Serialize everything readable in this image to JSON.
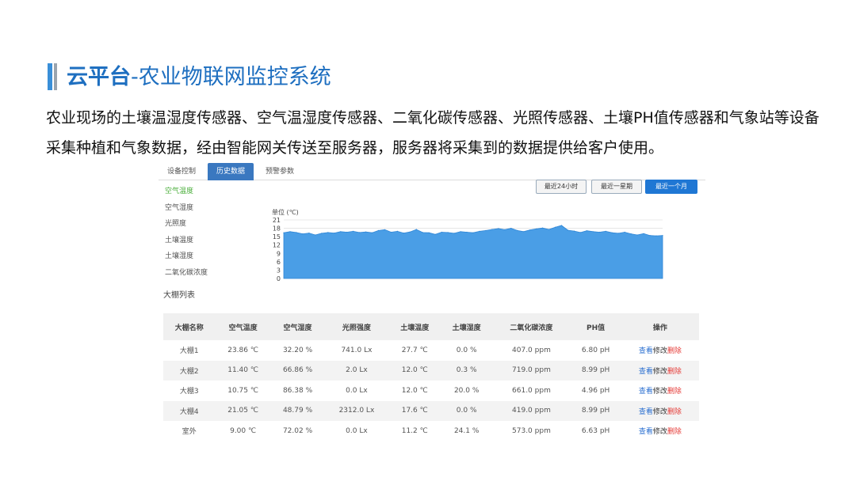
{
  "heading": {
    "title_bold": "云平台",
    "title_rest": "-农业物联网监控系统",
    "paragraph": "农业现场的土壤温湿度传感器、空气温湿度传感器、二氧化碳传感器、光照传感器、土壤PH值传感器和气象站等设备采集种植和气象数据，经由智能网关传送至服务器，服务器将采集到的数据提供给客户使用。"
  },
  "colors": {
    "accent": "#3a8fd8",
    "chart_fill": "#4a9ee6",
    "tab_active": "#3a78c0",
    "range_active": "#1f77d4",
    "link": "#2a6fd0",
    "delete": "#e53935"
  },
  "tabs": [
    {
      "label": "设备控制",
      "active": false
    },
    {
      "label": "历史数据",
      "active": true
    },
    {
      "label": "预警参数",
      "active": false
    }
  ],
  "sidebar": [
    {
      "label": "空气温度",
      "active": true
    },
    {
      "label": "空气湿度",
      "active": false
    },
    {
      "label": "光照度",
      "active": false
    },
    {
      "label": "土壤温度",
      "active": false
    },
    {
      "label": "土壤湿度",
      "active": false
    },
    {
      "label": "二氧化碳浓度",
      "active": false
    }
  ],
  "range_buttons": [
    {
      "label": "最近24小时",
      "active": false
    },
    {
      "label": "最近一星期",
      "active": false
    },
    {
      "label": "最近一个月",
      "active": true
    }
  ],
  "chart_data": {
    "type": "area",
    "unit_label": "单位 (℃)",
    "ylim": [
      0,
      21
    ],
    "yticks": [
      21,
      18,
      15,
      12,
      9,
      6,
      3,
      0
    ],
    "grid": true,
    "values": [
      16.4,
      16.8,
      16.5,
      16.0,
      16.3,
      15.6,
      16.2,
      16.5,
      16.3,
      16.8,
      16.6,
      16.9,
      16.5,
      16.7,
      16.4,
      17.2,
      17.5,
      16.6,
      16.9,
      16.3,
      16.7,
      17.6,
      16.5,
      16.4,
      15.8,
      16.6,
      16.5,
      16.2,
      16.8,
      16.6,
      16.4,
      16.9,
      17.2,
      17.6,
      17.9,
      17.5,
      18.0,
      17.2,
      16.8,
      17.4,
      17.8,
      18.1,
      17.6,
      18.4,
      19.0,
      17.3,
      17.0,
      16.5,
      17.1,
      16.8,
      16.6,
      16.9,
      16.4,
      16.2,
      16.6,
      16.0,
      15.6,
      16.1,
      15.4,
      15.3,
      15.4
    ]
  },
  "list": {
    "title": "大棚列表",
    "headers": [
      "大棚名称",
      "空气温度",
      "空气湿度",
      "光照强度",
      "土壤温度",
      "土壤湿度",
      "二氧化碳浓度",
      "PH值",
      "操作"
    ],
    "rows": [
      [
        "大棚1",
        "23.86 ℃",
        "32.20 %",
        "741.0 Lx",
        "27.7 ℃",
        "0.0 %",
        "407.0 ppm",
        "6.80 pH"
      ],
      [
        "大棚2",
        "11.40 ℃",
        "66.86 %",
        "2.0 Lx",
        "12.0 ℃",
        "0.3 %",
        "719.0 ppm",
        "8.99 pH"
      ],
      [
        "大棚3",
        "10.75 ℃",
        "86.38 %",
        "0.0 Lx",
        "12.0 ℃",
        "20.0 %",
        "661.0 ppm",
        "4.96 pH"
      ],
      [
        "大棚4",
        "21.05 ℃",
        "48.79 %",
        "2312.0 Lx",
        "17.6 ℃",
        "0.0 %",
        "419.0 ppm",
        "8.99 pH"
      ],
      [
        "室外",
        "9.00 ℃",
        "72.02 %",
        "0.0 Lx",
        "11.2 ℃",
        "24.1 %",
        "573.0 ppm",
        "6.63 pH"
      ]
    ],
    "actions": {
      "view": "查看",
      "edit": "修改",
      "delete": "删除"
    }
  }
}
